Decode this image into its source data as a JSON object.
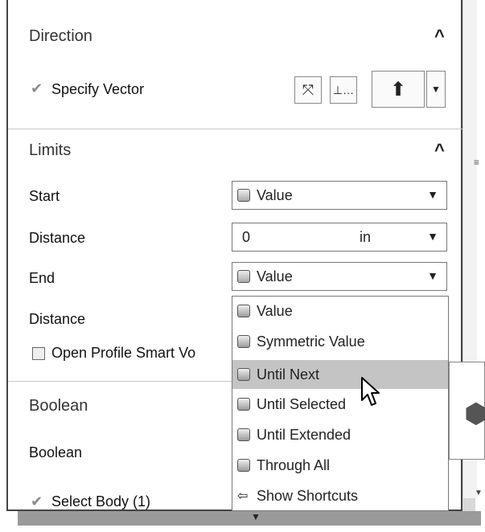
{
  "direction": {
    "title": "Direction",
    "specify_vector": "Specify Vector"
  },
  "limits": {
    "title": "Limits",
    "start_label": "Start",
    "start_value": "Value",
    "distance1_label": "Distance",
    "distance1_value": "0",
    "distance1_unit": "in",
    "end_label": "End",
    "end_value": "Value",
    "distance2_label": "Distance",
    "open_profile": "Open Profile Smart Vo"
  },
  "boolean": {
    "title": "Boolean",
    "boolean_label": "Boolean",
    "select_body": "Select Body (1)"
  },
  "menu": {
    "items": [
      {
        "label": "Value",
        "icon": "value-icon"
      },
      {
        "label": "Symmetric Value",
        "icon": "symmetric-value-icon"
      },
      {
        "label": "Until Next",
        "icon": "until-next-icon"
      },
      {
        "label": "Until Selected",
        "icon": "until-selected-icon"
      },
      {
        "label": "Until Extended",
        "icon": "until-extended-icon"
      },
      {
        "label": "Through All",
        "icon": "through-all-icon"
      },
      {
        "label": "Show Shortcuts",
        "icon": "show-shortcuts-icon"
      }
    ],
    "highlighted": "Until Next"
  }
}
